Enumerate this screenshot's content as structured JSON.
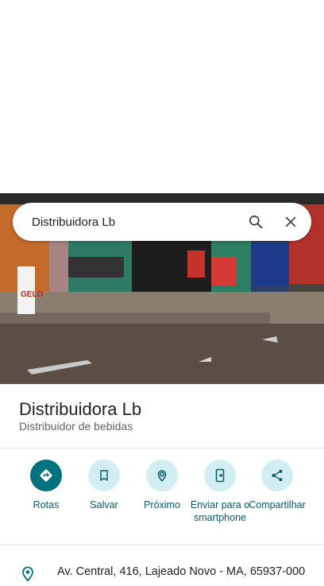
{
  "search": {
    "query": "Distribuidora Lb"
  },
  "place": {
    "name": "Distribuidora Lb",
    "category": "Distribuidor de bebidas"
  },
  "photo": {
    "sign_text": "GELO"
  },
  "actions": [
    {
      "label": "Rotas",
      "icon": "directions-icon",
      "primary": true
    },
    {
      "label": "Salvar",
      "icon": "bookmark-icon",
      "primary": false
    },
    {
      "label": "Próximo",
      "icon": "nearby-icon",
      "primary": false
    },
    {
      "label": "Enviar para o smartphone",
      "icon": "send-to-phone-icon",
      "primary": false
    },
    {
      "label": "Compartilhar",
      "icon": "share-icon",
      "primary": false
    }
  ],
  "address": {
    "text": "Av. Central, 416, Lajeado Novo - MA, 65937-000"
  },
  "colors": {
    "accent": "#00727f",
    "action_bg": "#d2eef2",
    "action_text": "#0b5b64"
  }
}
